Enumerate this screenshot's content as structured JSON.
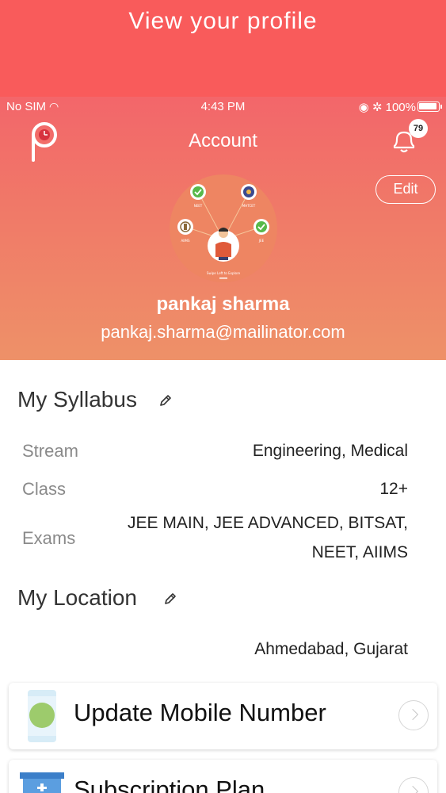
{
  "banner": {
    "title": "View your profile"
  },
  "status_bar": {
    "carrier": "No SIM",
    "time": "4:43 PM",
    "battery": "100%"
  },
  "nav": {
    "title": "Account",
    "notification_count": "79",
    "edit_label": "Edit"
  },
  "profile": {
    "name": "pankaj sharma",
    "email": "pankaj.sharma@mailinator.com",
    "avatar_labels": [
      "NEET",
      "MHTCET",
      "AIIMS",
      "JEE",
      "Swipe Left to Explore"
    ]
  },
  "syllabus": {
    "title": "My Syllabus",
    "rows": [
      {
        "label": "Stream",
        "value": "Engineering, Medical"
      },
      {
        "label": "Class",
        "value": "12+"
      },
      {
        "label": "Exams",
        "value_line1": "JEE MAIN, JEE ADVANCED, BITSAT,",
        "value_line2": "NEET, AIIMS"
      }
    ]
  },
  "location": {
    "title": "My Location",
    "value": "Ahmedabad, Gujarat"
  },
  "cards": [
    {
      "label": "Update Mobile Number",
      "icon": "phone-icon"
    },
    {
      "label": "Subscription Plan",
      "icon": "subscription-icon"
    }
  ],
  "colors": {
    "banner": "#f95b5b",
    "header_top": "#f3666a",
    "header_bottom": "#ee9168",
    "check_green": "#57b94a"
  }
}
